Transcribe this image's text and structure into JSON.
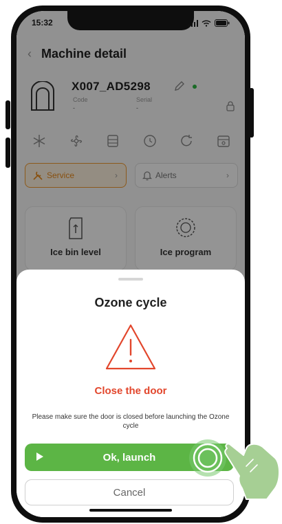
{
  "status_bar": {
    "time": "15:32"
  },
  "header": {
    "title": "Machine detail"
  },
  "machine": {
    "code": "X007_AD5298",
    "code_label": "Code",
    "serial_label": "Serial",
    "code_value": "-",
    "serial_value": "-",
    "status_color": "#2db843"
  },
  "chips": {
    "service_label": "Service",
    "alerts_label": "Alerts"
  },
  "cards": [
    {
      "label": "Ice bin level",
      "icon": "ice-bin-icon"
    },
    {
      "label": "Ice program",
      "icon": "ice-program-icon"
    }
  ],
  "modal": {
    "title": "Ozone cycle",
    "subtitle": "Close the door",
    "message": "Please make sure the door is closed before launching the Ozone cycle",
    "launch_label": "Ok, launch",
    "cancel_label": "Cancel"
  },
  "colors": {
    "accent_green": "#5cb545",
    "warning_red": "#e2462c",
    "service_orange": "#ea8a1a"
  }
}
